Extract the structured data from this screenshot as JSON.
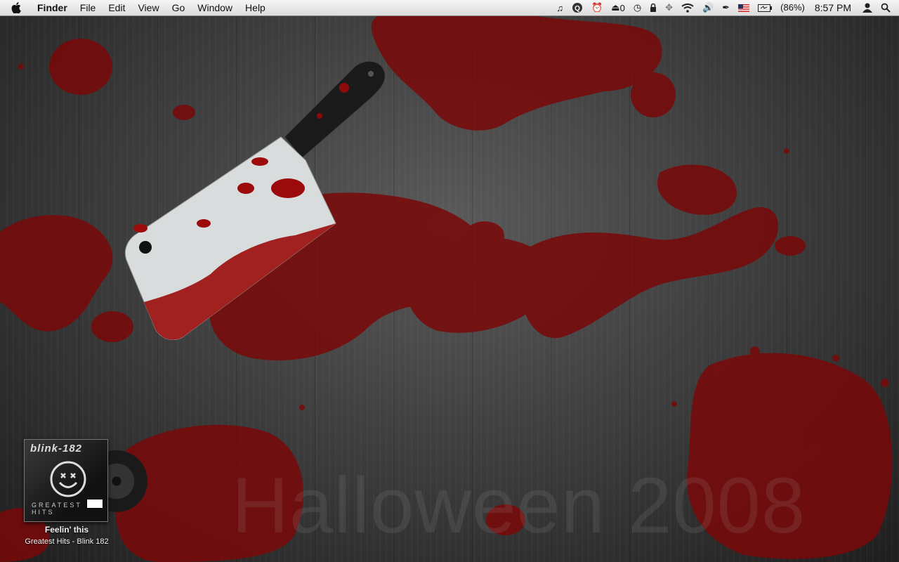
{
  "menubar": {
    "app_name": "Finder",
    "items": [
      "File",
      "Edit",
      "View",
      "Go",
      "Window",
      "Help"
    ],
    "status": {
      "eject_count": "0",
      "battery": "(86%)",
      "clock": "8:57 PM"
    },
    "icons": [
      "apple-icon",
      "music-note-icon",
      "q-icon",
      "alarm-clock-icon",
      "eject-icon",
      "time-machine-icon",
      "lock-icon",
      "bluetooth-icon",
      "wifi-icon",
      "volume-icon",
      "pen-icon",
      "us-flag-icon",
      "battery-icon",
      "user-icon",
      "spotlight-icon"
    ]
  },
  "desktop": {
    "wallpaper_text": "Halloween 2008"
  },
  "now_playing": {
    "album_band": "blink-182",
    "album_subtitle": "GREATEST HITS",
    "track": "Feelin' this",
    "album_artist": "Greatest Hits - Blink 182"
  },
  "colors": {
    "blood": "#8e0a0a",
    "menubar": "#e6e6e6"
  }
}
